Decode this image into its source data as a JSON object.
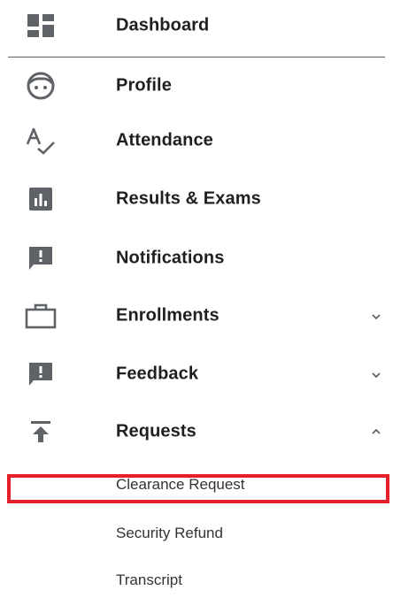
{
  "nav": {
    "items": [
      {
        "label": "Dashboard",
        "icon": "dashboard-icon"
      },
      {
        "label": "Profile",
        "icon": "face-icon"
      },
      {
        "label": "Attendance",
        "icon": "spellcheck-icon"
      },
      {
        "label": "Results & Exams",
        "icon": "bar-chart-icon"
      },
      {
        "label": "Notifications",
        "icon": "feedback-icon"
      },
      {
        "label": "Enrollments",
        "icon": "briefcase-icon",
        "expandable": true,
        "expanded": false
      },
      {
        "label": "Feedback",
        "icon": "feedback-icon",
        "expandable": true,
        "expanded": false
      },
      {
        "label": "Requests",
        "icon": "vertical-align-top-icon",
        "expandable": true,
        "expanded": true
      }
    ]
  },
  "requests_submenu": {
    "items": [
      {
        "label": "Clearance Request",
        "highlighted": true
      },
      {
        "label": "Security Refund"
      },
      {
        "label": "Transcript"
      }
    ]
  },
  "colors": {
    "icon": "#5f6368",
    "text": "#1f1f1f",
    "highlight": "#e5202a"
  }
}
